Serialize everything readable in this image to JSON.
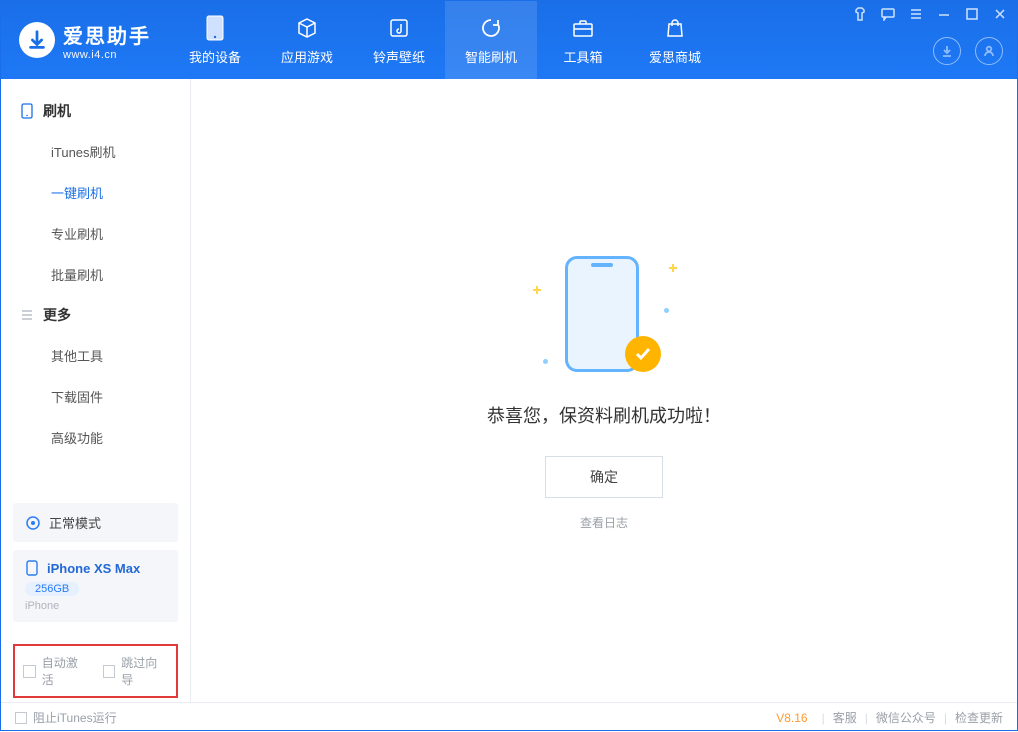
{
  "logo": {
    "title": "爱思助手",
    "url": "www.i4.cn"
  },
  "nav": {
    "my_device": "我的设备",
    "apps_games": "应用游戏",
    "ring_wallpaper": "铃声壁纸",
    "smart_flash": "智能刷机",
    "toolbox": "工具箱",
    "store": "爱思商城"
  },
  "sidebar": {
    "flash_header": "刷机",
    "items": {
      "itunes_flash": "iTunes刷机",
      "one_key_flash": "一键刷机",
      "pro_flash": "专业刷机",
      "batch_flash": "批量刷机"
    },
    "more_header": "更多",
    "more": {
      "other_tools": "其他工具",
      "download_fw": "下载固件",
      "advanced": "高级功能"
    }
  },
  "mode_card": {
    "label": "正常模式"
  },
  "device_card": {
    "name": "iPhone XS Max",
    "storage": "256GB",
    "type": "iPhone"
  },
  "options": {
    "auto_activate": "自动激活",
    "skip_guide": "跳过向导"
  },
  "main": {
    "success_msg": "恭喜您，保资料刷机成功啦！",
    "ok": "确定",
    "view_log": "查看日志"
  },
  "footer": {
    "block_itunes": "阻止iTunes运行",
    "version": "V8.16",
    "support": "客服",
    "wechat": "微信公众号",
    "check_update": "检查更新"
  }
}
